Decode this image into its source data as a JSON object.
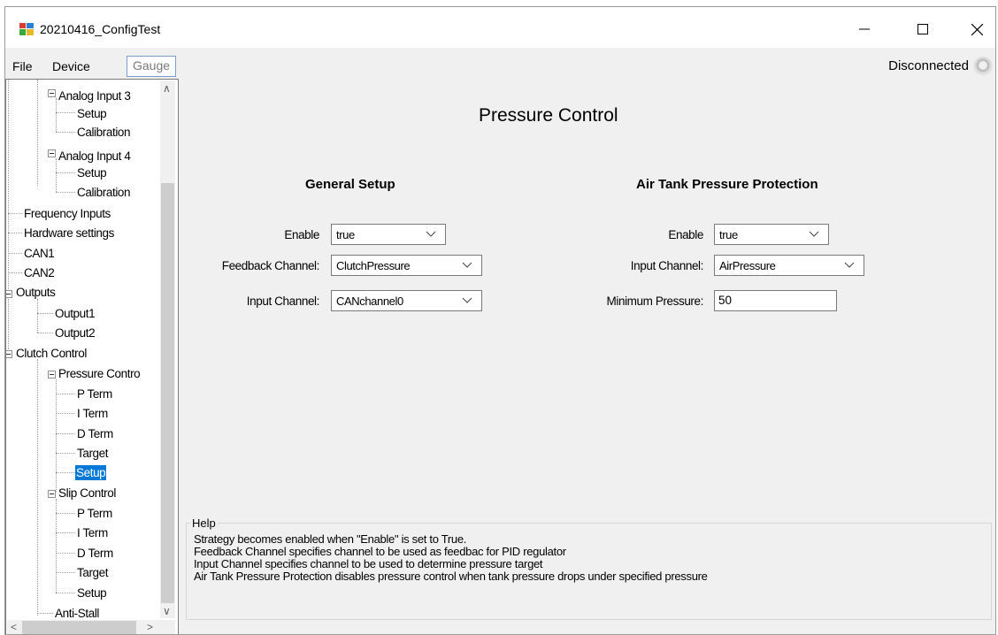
{
  "window": {
    "title": "20210416_ConfigTest",
    "minimize_glyph": "—",
    "maximize_glyph": "☐",
    "close_glyph": "✕"
  },
  "menu": {
    "file": "File",
    "device": "Device",
    "gauge": "Gauge"
  },
  "connection": {
    "status": "Disconnected"
  },
  "tree": {
    "nodes": {
      "analog_input_3": "Analog Input 3",
      "ai3_setup": "Setup",
      "ai3_calibration": "Calibration",
      "analog_input_4": "Analog Input 4",
      "ai4_setup": "Setup",
      "ai4_calibration": "Calibration",
      "frequency_inputs": "Frequency Inputs",
      "hardware_settings": "Hardware settings",
      "can1": "CAN1",
      "can2": "CAN2",
      "outputs": "Outputs",
      "output1": "Output1",
      "output2": "Output2",
      "clutch_control": "Clutch Control",
      "pressure_control": "Pressure Contro",
      "pc_p_term": "P Term",
      "pc_i_term": "I Term",
      "pc_d_term": "D Term",
      "pc_target": "Target",
      "pc_setup": "Setup",
      "slip_control": "Slip Control",
      "sc_p_term": "P Term",
      "sc_i_term": "I Term",
      "sc_d_term": "D Term",
      "sc_target": "Target",
      "sc_setup": "Setup",
      "anti_stall": "Anti-Stall"
    },
    "selected": "pc_setup",
    "scroll_up_glyph": "∧",
    "scroll_down_glyph": "∨",
    "scroll_left_glyph": "<",
    "scroll_right_glyph": ">"
  },
  "page": {
    "title": "Pressure Control"
  },
  "general_setup": {
    "heading": "General Setup",
    "enable_label": "Enable",
    "enable_value": "true",
    "feedback_label": "Feedback Channel:",
    "feedback_value": "ClutchPressure",
    "input_label": "Input Channel:",
    "input_value": "CANchannel0"
  },
  "air_tank": {
    "heading": "Air Tank Pressure Protection",
    "enable_label": "Enable",
    "enable_value": "true",
    "input_label": "Input Channel:",
    "input_value": "AirPressure",
    "min_pressure_label": "Minimum Pressure:",
    "min_pressure_value": "50"
  },
  "help": {
    "title": "Help",
    "lines": [
      "Strategy becomes enabled when \"Enable\" is set to True.",
      "Feedback Channel specifies channel to be used as feedbac for PID regulator",
      "Input Channel specifies channel to be used to determine pressure target",
      "Air Tank Pressure Protection disables pressure control when tank pressure drops under specified pressure"
    ]
  },
  "icons": {
    "app": "app-window-icon",
    "status_led": "status-led-icon",
    "expand_collapse": "collapse-icon",
    "dropdown": "chevron-down-icon"
  },
  "colors": {
    "selection": "#0078d7",
    "window_bg": "#f0f0f0",
    "tree_bg": "#ffffff"
  }
}
